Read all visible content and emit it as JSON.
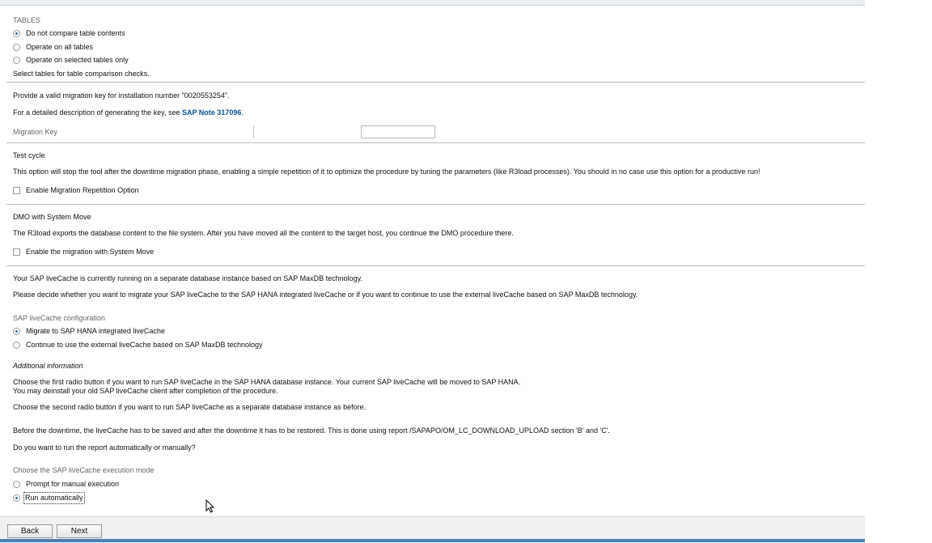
{
  "tables": {
    "heading": "TABLES",
    "options": [
      {
        "label": "Do not compare table contents",
        "selected": true
      },
      {
        "label": "Operate on all tables",
        "selected": false
      },
      {
        "label": "Operate on selected tables only",
        "selected": false
      }
    ],
    "hint": "Select tables for table comparison checks."
  },
  "migration_key": {
    "instruction": "Provide a valid migration key for installation number \"0020553254\".",
    "description_prefix": "For a detailed description of generating the key, see ",
    "note_link": "SAP Note 317096",
    "description_suffix": ".",
    "label": "Migration Key",
    "value": ""
  },
  "test_cycle": {
    "heading": "Test cycle",
    "description": "This option will stop the tool after the downtime migration phase, enabling a simple repetition of it to optimize the procedure by tuning the parameters (like R3load processes). You should in no case use this option for a productive run!",
    "checkbox_label": "Enable Migration Repetition Option",
    "checked": false
  },
  "dmo": {
    "heading": "DMO with System Move",
    "description": "The R3load exports the database content to the file system. After you have moved all the content to the target host, you continue the DMO procedure there.",
    "checkbox_label": "Enable the migration with System Move",
    "checked": false
  },
  "livecache": {
    "status": "Your SAP liveCache is currently running on a separate database instance based on SAP MaxDB technology.",
    "decision": "Please decide whether you want to migrate your SAP liveCache to the SAP HANA integrated liveCache or if you want to continue to use the external liveCache based on SAP MaxDB technology.",
    "config_label": "SAP liveCache configuration",
    "options": [
      {
        "label": "Migrate to SAP HANA integrated liveCache",
        "selected": true
      },
      {
        "label": "Continue to use the external liveCache based on SAP MaxDB technology",
        "selected": false
      }
    ],
    "additional_heading": "Additional information",
    "info_line1": "Choose the first radio button if you want to run SAP liveCache in the SAP HANA database instance. Your current SAP liveCache will be moved to SAP HANA.",
    "info_line2": "You may deinstall your old SAP liveCache client after completion of the procedure.",
    "info_line3": "Choose the second radio button if you want to run SAP liveCache as a separate database instance as before.",
    "downtime_note": "Before the downtime, the liveCache has to be saved and after the downtime it has to be restored. This is done using report /SAPAPO/OM_LC_DOWNLOAD_UPLOAD section 'B' and 'C'.",
    "question": "Do you want to run the report automatically or manually?",
    "mode_label": "Choose the SAP liveCache execution mode",
    "modes": [
      {
        "label": "Prompt for manual execution",
        "selected": false
      },
      {
        "label": "Run automatically",
        "selected": true
      }
    ]
  },
  "footer": {
    "back_label": "Back",
    "next_label": "Next"
  },
  "colors": {
    "link": "#0a4f8f",
    "radio_selected": "#3a6ea5",
    "separator": "#b8b8b8"
  },
  "icons": {
    "cursor": "mouse-pointer-icon"
  }
}
